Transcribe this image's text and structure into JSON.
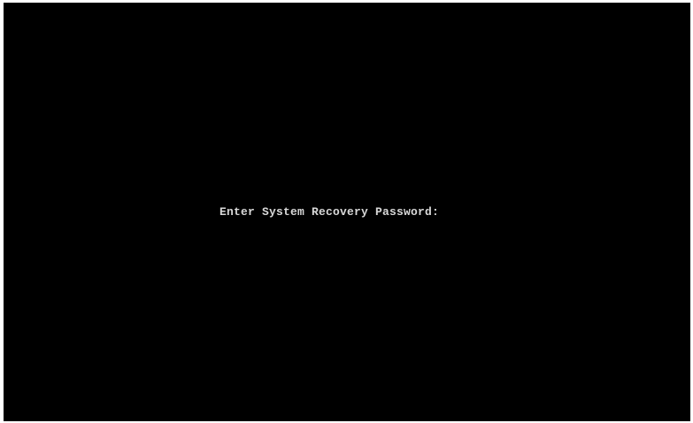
{
  "recovery_screen": {
    "prompt_label": "Enter System Recovery Password:",
    "password_value": ""
  }
}
